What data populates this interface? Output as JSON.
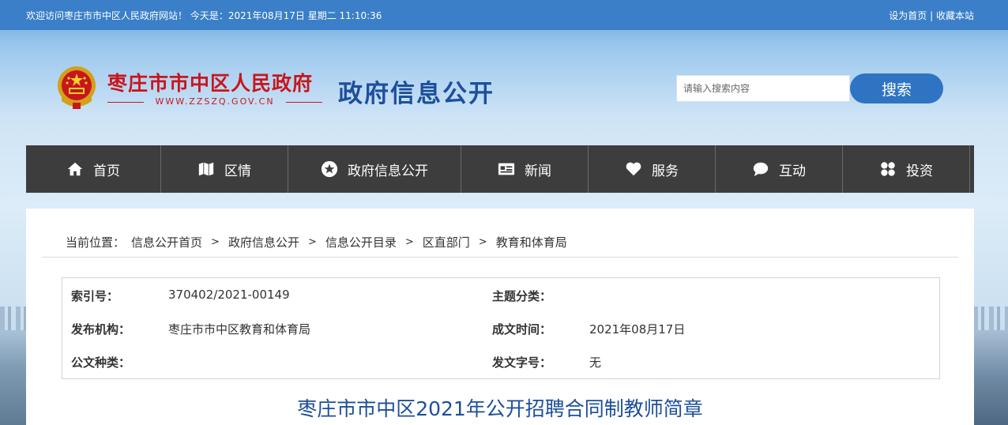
{
  "topbar": {
    "welcome": "欢迎访问枣庄市市中区人民政府网站！ 今天是：2021年08月17日 星期二 11:10:36",
    "set_home": "设为首页",
    "separator": " | ",
    "bookmark": "收藏本站"
  },
  "header": {
    "site_name": "枣庄市市中区人民政府",
    "site_url": "WWW.ZZSZQ.GOV.CN",
    "section_title": "政府信息公开",
    "search": {
      "placeholder": "请输入搜索内容",
      "button": "搜索"
    }
  },
  "nav": {
    "items": [
      {
        "label": "首页",
        "icon": "home-icon"
      },
      {
        "label": "区情",
        "icon": "map-icon"
      },
      {
        "label": "政府信息公开",
        "icon": "star-icon"
      },
      {
        "label": "新闻",
        "icon": "news-card-icon"
      },
      {
        "label": "服务",
        "icon": "heart-icon"
      },
      {
        "label": "互动",
        "icon": "chat-bubble-icon"
      },
      {
        "label": "投资",
        "icon": "grid-icon"
      }
    ]
  },
  "breadcrumb": {
    "prefix": "当前位置：",
    "sep": ">",
    "items": [
      "信息公开首页",
      "政府信息公开",
      "信息公开目录",
      "区直部门",
      "教育和体育局"
    ]
  },
  "meta": {
    "index_label": "索引号：",
    "index_value": "370402/2021-00149",
    "topic_label": "主题分类：",
    "topic_value": "",
    "publisher_label": "发布机构：",
    "publisher_value": "枣庄市市中区教育和体育局",
    "date_label": "成文时间：",
    "date_value": "2021年08月17日",
    "doctype_label": "公文种类：",
    "doctype_value": "",
    "docno_label": "发文字号：",
    "docno_value": "无"
  },
  "document": {
    "title": "枣庄市市中区2021年公开招聘合同制教师简章"
  },
  "colors": {
    "topbar": "#3a7fc8",
    "nav_bg": "#3d3d3d",
    "brand_red": "#c8161d",
    "title_blue": "#1d4f9a",
    "search_button": "#2f74c3"
  }
}
